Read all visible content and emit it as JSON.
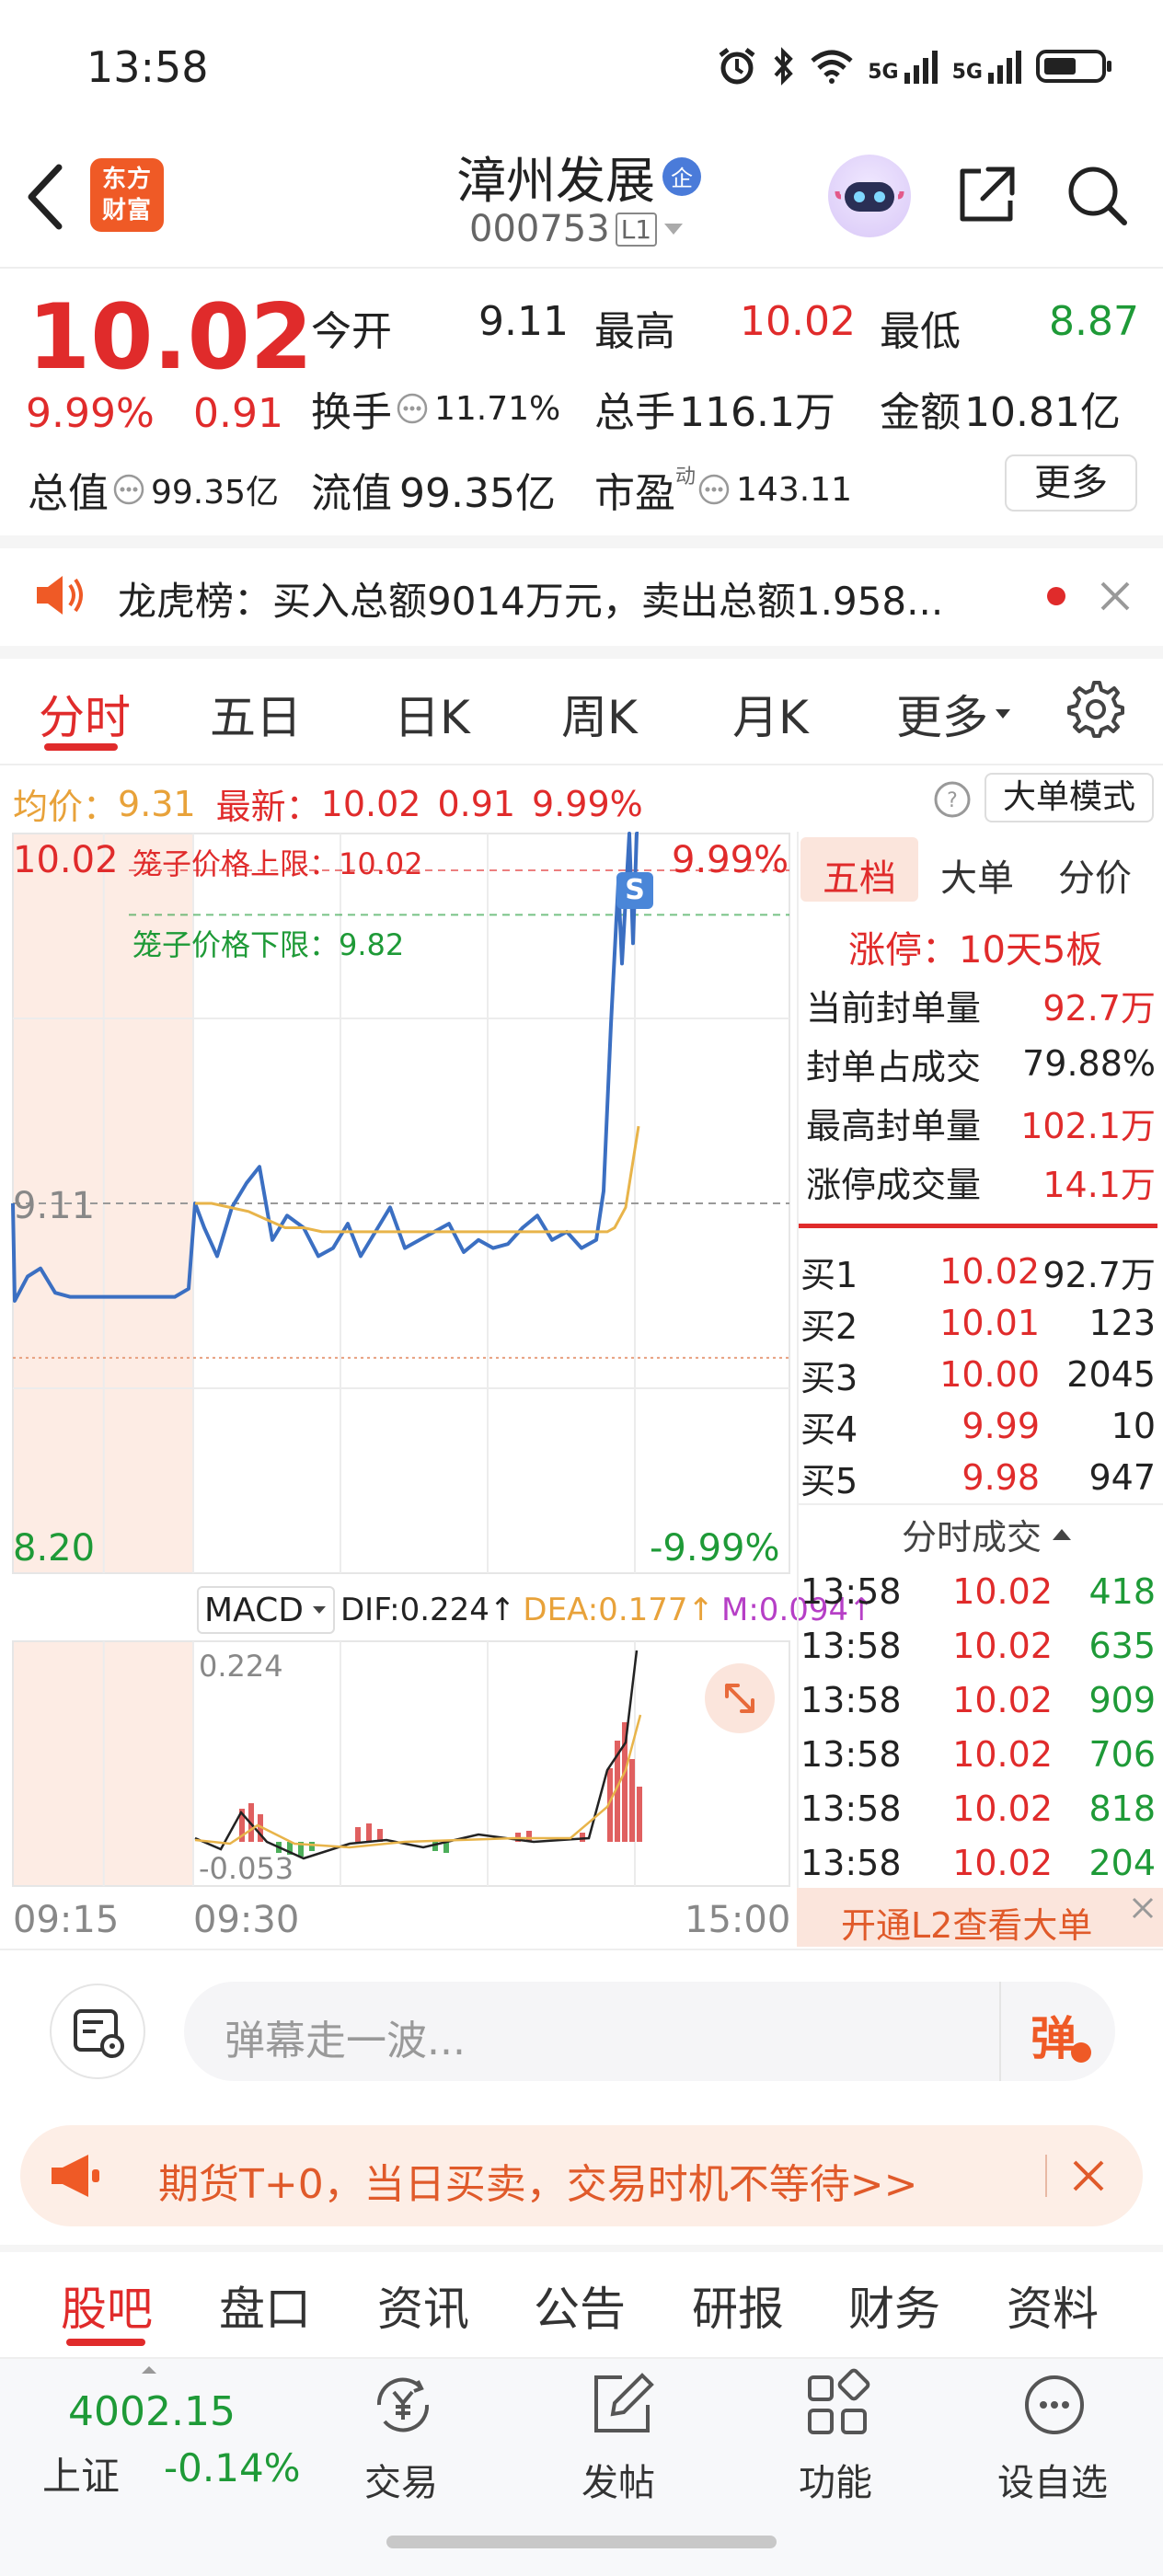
{
  "status_bar": {
    "time": "13:58",
    "signal_labels": [
      "5G",
      "5G"
    ]
  },
  "header": {
    "logo_text": "东方财富",
    "stock_name": "漳州发展",
    "badge": "企",
    "stock_code": "000753",
    "level": "L1"
  },
  "quote": {
    "price": "10.02",
    "change_pct": "9.99%",
    "change": "0.91",
    "open_label": "今开",
    "open": "9.11",
    "high_label": "最高",
    "high": "10.02",
    "low_label": "最低",
    "low": "8.87",
    "turnover_label": "换手",
    "turnover": "11.71%",
    "volume_label": "总手",
    "volume": "116.1万",
    "amount_label": "金额",
    "amount": "10.81亿",
    "mktcap_label": "总值",
    "mktcap": "99.35亿",
    "float_label": "流值",
    "float": "99.35亿",
    "pe_label": "市盈",
    "pe_sup": "动",
    "pe": "143.11",
    "more_button": "更多"
  },
  "notice": {
    "text": "龙虎榜：买入总额9014万元，卖出总额1.958..."
  },
  "chart_tabs": [
    "分时",
    "五日",
    "日K",
    "周K",
    "月K",
    "更多"
  ],
  "info_line": {
    "avg_label": "均价：",
    "avg": "9.31",
    "latest_label": "最新：",
    "latest": "10.02",
    "change": "0.91",
    "pct": "9.99%",
    "mode_button": "大单模式"
  },
  "chart_data": {
    "type": "line",
    "x_ticks": [
      "09:15",
      "09:30",
      "15:00"
    ],
    "ylim": [
      8.2,
      10.02
    ],
    "y_top_label": "10.02",
    "y_bottom_label": "8.20",
    "y_mid_label": "9.11",
    "pct_top": "9.99%",
    "pct_bottom": "-9.99%",
    "upper_limit_label": "笼子价格上限：10.02",
    "lower_limit_label": "笼子价格下限：9.82",
    "marker": "S",
    "series": [
      {
        "values": [
          9.11,
          8.87,
          8.93,
          8.95,
          8.89,
          8.88,
          8.88,
          8.88,
          8.9,
          9.11,
          9.05,
          8.98,
          9.1,
          9.16,
          9.2,
          9.02,
          9.08,
          9.05,
          8.98,
          9.0,
          9.06,
          8.98,
          9.04,
          9.1,
          9.0,
          9.02,
          9.04,
          9.06,
          8.99,
          9.02,
          9.0,
          9.01,
          9.05,
          9.08,
          9.02,
          9.04,
          9.0,
          9.02,
          9.14,
          9.55,
          9.9,
          9.7,
          10.02,
          9.75,
          10.02,
          10.02
        ]
      },
      {
        "values": [
          9.11,
          9.11,
          9.1,
          9.09,
          9.07,
          9.05,
          9.05,
          9.04,
          9.04,
          9.04,
          9.04,
          9.04,
          9.04,
          9.04,
          9.04,
          9.04,
          9.04,
          9.04,
          9.04,
          9.04,
          9.04,
          9.04,
          9.04,
          9.04,
          9.05,
          9.1,
          9.3
        ]
      }
    ],
    "macd": {
      "label": "MACD",
      "dif": "DIF:0.224↑",
      "dea": "DEA:0.177↑",
      "m": "M:0.094↑",
      "top_label": "0.224",
      "bottom_label": "-0.053"
    }
  },
  "order_book": {
    "tabs": [
      "五档",
      "大单",
      "分价"
    ],
    "limit_status": "涨停：10天5板",
    "stats": [
      {
        "label": "当前封单量",
        "value": "92.7万"
      },
      {
        "label": "封单占成交",
        "value": "79.88%"
      },
      {
        "label": "最高封单量",
        "value": "102.1万"
      },
      {
        "label": "涨停成交量",
        "value": "14.1万"
      }
    ],
    "bids": [
      {
        "label": "买1",
        "price": "10.02",
        "vol": "92.7万"
      },
      {
        "label": "买2",
        "price": "10.01",
        "vol": "123"
      },
      {
        "label": "买3",
        "price": "10.00",
        "vol": "2045"
      },
      {
        "label": "买4",
        "price": "9.99",
        "vol": "10"
      },
      {
        "label": "买5",
        "price": "9.98",
        "vol": "947"
      }
    ],
    "ticks_title": "分时成交",
    "ticks": [
      {
        "time": "13:58",
        "price": "10.02",
        "vol": "418"
      },
      {
        "time": "13:58",
        "price": "10.02",
        "vol": "635"
      },
      {
        "time": "13:58",
        "price": "10.02",
        "vol": "909"
      },
      {
        "time": "13:58",
        "price": "10.02",
        "vol": "706"
      },
      {
        "time": "13:58",
        "price": "10.02",
        "vol": "818"
      },
      {
        "time": "13:58",
        "price": "10.02",
        "vol": "204"
      }
    ],
    "l2_button": "开通L2查看大单"
  },
  "danmaku": {
    "placeholder": "弹幕走一波...",
    "send_label": "弹"
  },
  "promo": {
    "text": "期货T+0，当日买卖，交易时机不等待>>"
  },
  "section_tabs": [
    "股吧",
    "盘口",
    "资讯",
    "公告",
    "研报",
    "财务",
    "资料"
  ],
  "bottom_bar": {
    "index_value": "4002.15",
    "index_name": "上证",
    "index_change": "-0.14%",
    "items": [
      "交易",
      "发帖",
      "功能",
      "设自选"
    ]
  }
}
